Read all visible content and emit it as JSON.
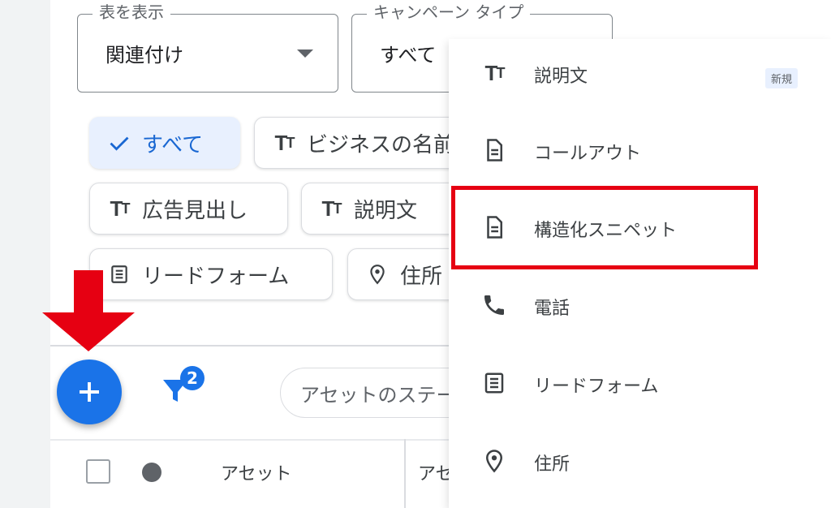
{
  "filters": {
    "table_view": {
      "legend": "表を表示",
      "value": "関連付け"
    },
    "campaign_type": {
      "legend": "キャンペーン タイプ",
      "value": "すべて"
    }
  },
  "chips": [
    {
      "label": "すべて",
      "icon": "check-icon",
      "selected": true
    },
    {
      "label": "ビジネスの名前",
      "icon": "text-fields-icon",
      "selected": false
    },
    {
      "label": "広告見出し",
      "icon": "text-fields-icon",
      "selected": false
    },
    {
      "label": "説明文",
      "icon": "text-fields-icon",
      "selected": false
    },
    {
      "label": "リードフォーム",
      "icon": "form-icon",
      "selected": false
    },
    {
      "label": "住所",
      "icon": "location-pin-icon",
      "selected": false
    }
  ],
  "toolbar": {
    "add_button_icon": "plus-icon",
    "filter_count": "2",
    "search_placeholder": "アセットのステータス"
  },
  "table": {
    "columns": [
      "アセット",
      "アセ"
    ]
  },
  "menu": {
    "items": [
      {
        "label": "説明文",
        "icon": "text-fields-icon",
        "badge": "新規"
      },
      {
        "label": "コールアウト",
        "icon": "document-icon"
      },
      {
        "label": "構造化スニペット",
        "icon": "document-icon",
        "highlighted": true
      },
      {
        "label": "電話",
        "icon": "phone-icon"
      },
      {
        "label": "リードフォーム",
        "icon": "form-icon"
      },
      {
        "label": "住所",
        "icon": "location-pin-icon"
      }
    ]
  },
  "colors": {
    "accent": "#1a73e8",
    "chip_selected_bg": "#e8f0fe",
    "highlight": "#e60012"
  }
}
